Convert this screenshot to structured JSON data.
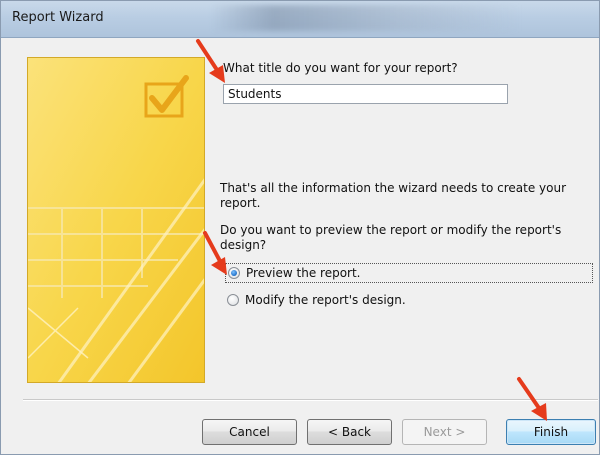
{
  "window": {
    "title": "Report Wizard"
  },
  "form": {
    "title_question": "What title do you want for your report?",
    "title_value": "Students",
    "info_text": "That's all the information the wizard needs to create your report.",
    "preview_question": "Do you want to preview the report or modify the report's design?",
    "options": [
      {
        "label": "Preview the report.",
        "selected": true
      },
      {
        "label": "Modify the report's design.",
        "selected": false
      }
    ]
  },
  "buttons": {
    "cancel": "Cancel",
    "back": "< Back",
    "next": "Next >",
    "finish": "Finish"
  },
  "colors": {
    "panel_yellow": "#f8d64a",
    "annotation_arrow": "#e53b1c",
    "radio_selected": "#1e6fc7"
  },
  "icons": {
    "side_panel": "report-wizard-illustration",
    "checkmark": "check-icon",
    "annotations": "red-arrow-icon"
  }
}
